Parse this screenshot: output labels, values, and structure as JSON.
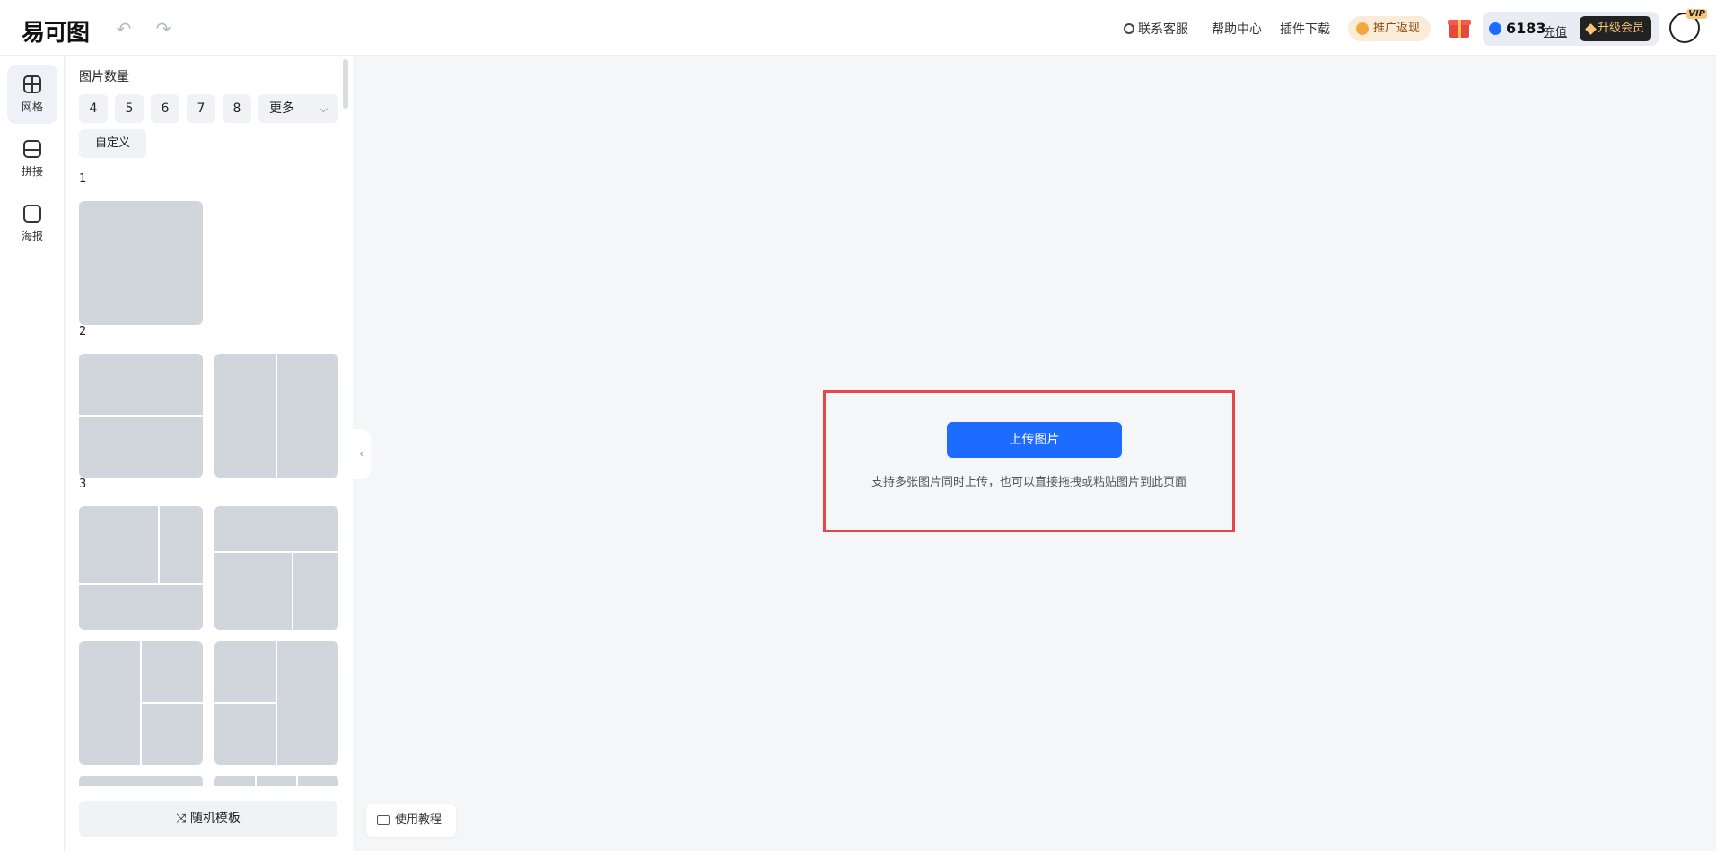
{
  "header": {
    "logo": "易可图",
    "undo_icon": "↶",
    "redo_icon": "↷",
    "links": [
      "联系客服",
      "帮助中心",
      "插件下载"
    ],
    "promo_label": "推广返现",
    "credits": "6183",
    "recharge_label": "充值",
    "upgrade_label": "升级会员",
    "vip_badge": "VIP"
  },
  "rail": {
    "items": [
      {
        "label": "网格",
        "icon": "grid-icon",
        "active": true
      },
      {
        "label": "拼接",
        "icon": "stitch-icon",
        "active": false
      },
      {
        "label": "海报",
        "icon": "poster-icon",
        "active": false
      }
    ]
  },
  "panel": {
    "title": "图片数量",
    "counts": [
      "4",
      "5",
      "6",
      "7",
      "8"
    ],
    "more_label": "更多",
    "chevron": "⌵",
    "custom_label": "自定义",
    "groups": [
      "1",
      "2",
      "3"
    ],
    "random_label": "随机模板",
    "random_icon": "⤨"
  },
  "collapse_icon": "‹",
  "upload": {
    "button_label": "上传图片",
    "hint": "支持多张图片同时上传，也可以直接拖拽或粘贴图片到此页面"
  },
  "tutorial_label": "使用教程",
  "colors": {
    "accent": "#1e6bff",
    "highlight_border": "#e8454a",
    "tile": "#d1d6dd"
  }
}
